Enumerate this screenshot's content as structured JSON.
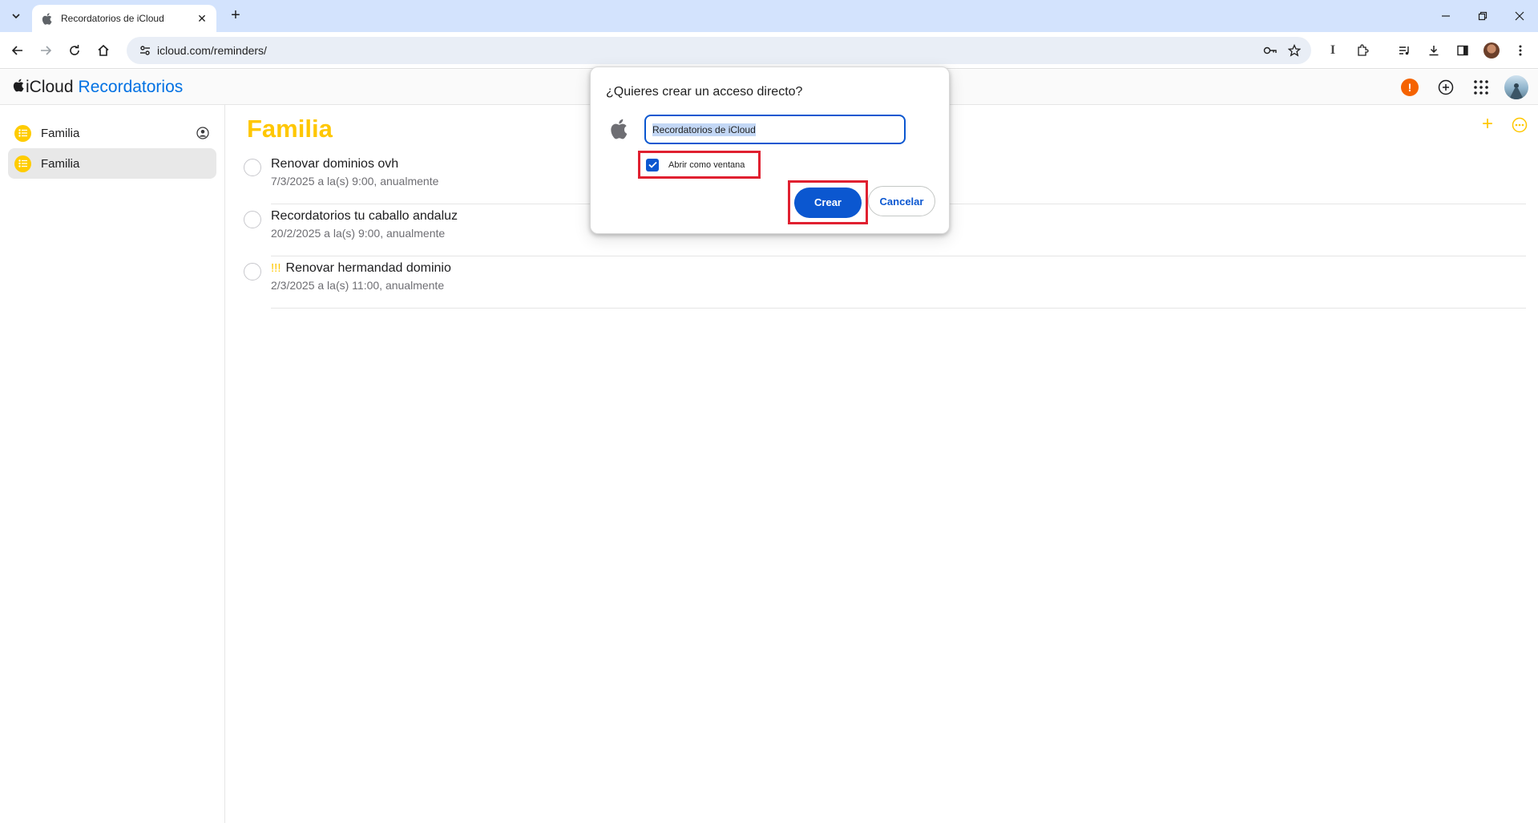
{
  "browser": {
    "tab_title": "Recordatorios de iCloud",
    "url": "icloud.com/reminders/"
  },
  "app": {
    "brand_icloud": "iCloud",
    "brand_app": "Recordatorios",
    "alert_badge": "!"
  },
  "sidebar": {
    "items": [
      {
        "label": "Familia",
        "shared": true,
        "selected": false
      },
      {
        "label": "Familia",
        "shared": false,
        "selected": true
      }
    ]
  },
  "main": {
    "list_title": "Familia",
    "add_symbol": "+",
    "reminders": [
      {
        "title": "Renovar dominios ovh",
        "priority": "",
        "subtitle": "7/3/2025 a la(s) 9:00, anualmente"
      },
      {
        "title": "Recordatorios tu caballo andaluz",
        "priority": "",
        "subtitle": "20/2/2025 a la(s) 9:00, anualmente"
      },
      {
        "title": "Renovar hermandad dominio",
        "priority": "!!!",
        "subtitle": "2/3/2025 a la(s) 11:00, anualmente"
      }
    ]
  },
  "dialog": {
    "title": "¿Quieres crear un acceso directo?",
    "input_value": "Recordatorios de iCloud",
    "checkbox_label": "Abrir como ventana",
    "checkbox_checked": true,
    "create_label": "Crear",
    "cancel_label": "Cancelar"
  },
  "colors": {
    "accent_yellow": "#ffc700",
    "chrome_blue": "#0b57d0",
    "highlight_red": "#e02030"
  }
}
